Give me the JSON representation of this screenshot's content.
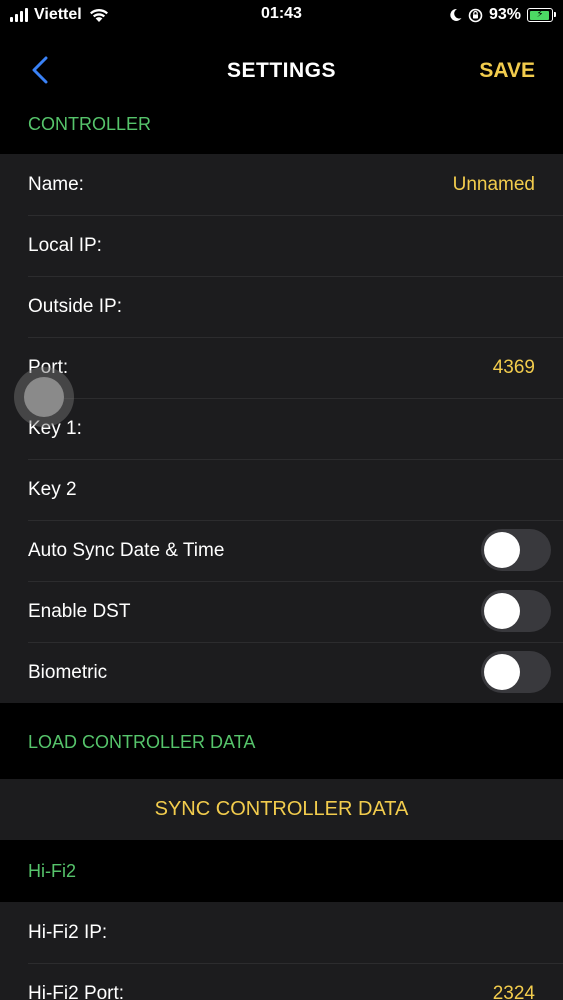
{
  "status_bar": {
    "carrier": "Viettel",
    "time": "01:43",
    "battery_percent": "93%",
    "battery_level": 0.93,
    "icons": [
      "signal-bars-icon",
      "wifi-icon",
      "moon-icon",
      "orientation-lock-icon",
      "battery-charging-icon"
    ]
  },
  "nav": {
    "back_icon": "chevron-left-icon",
    "title": "SETTINGS",
    "save_label": "SAVE"
  },
  "colors": {
    "accent": "#f2cc4d",
    "section_header": "#56c46b",
    "background": "#000000",
    "cell": "#1c1c1e",
    "back_arrow": "#3a82f7"
  },
  "controller": {
    "header": "CONTROLLER",
    "rows": [
      {
        "label": "Name:",
        "value": "Unnamed"
      },
      {
        "label": "Local IP:",
        "value": ""
      },
      {
        "label": "Outside IP:",
        "value": ""
      },
      {
        "label": "Port:",
        "value": "4369"
      },
      {
        "label": "Key 1:",
        "value": ""
      },
      {
        "label": "Key 2",
        "value": ""
      }
    ],
    "toggles": [
      {
        "label": "Auto Sync Date & Time",
        "on": false
      },
      {
        "label": "Enable DST",
        "on": false
      },
      {
        "label": "Biometric",
        "on": false
      }
    ]
  },
  "load_controller": {
    "header": "LOAD CONTROLLER DATA",
    "sync_button": "SYNC CONTROLLER DATA"
  },
  "hifi": {
    "header": "Hi-Fi2",
    "rows": [
      {
        "label": "Hi-Fi2 IP:",
        "value": ""
      },
      {
        "label": "Hi-Fi2 Port:",
        "value": "2324"
      }
    ]
  }
}
